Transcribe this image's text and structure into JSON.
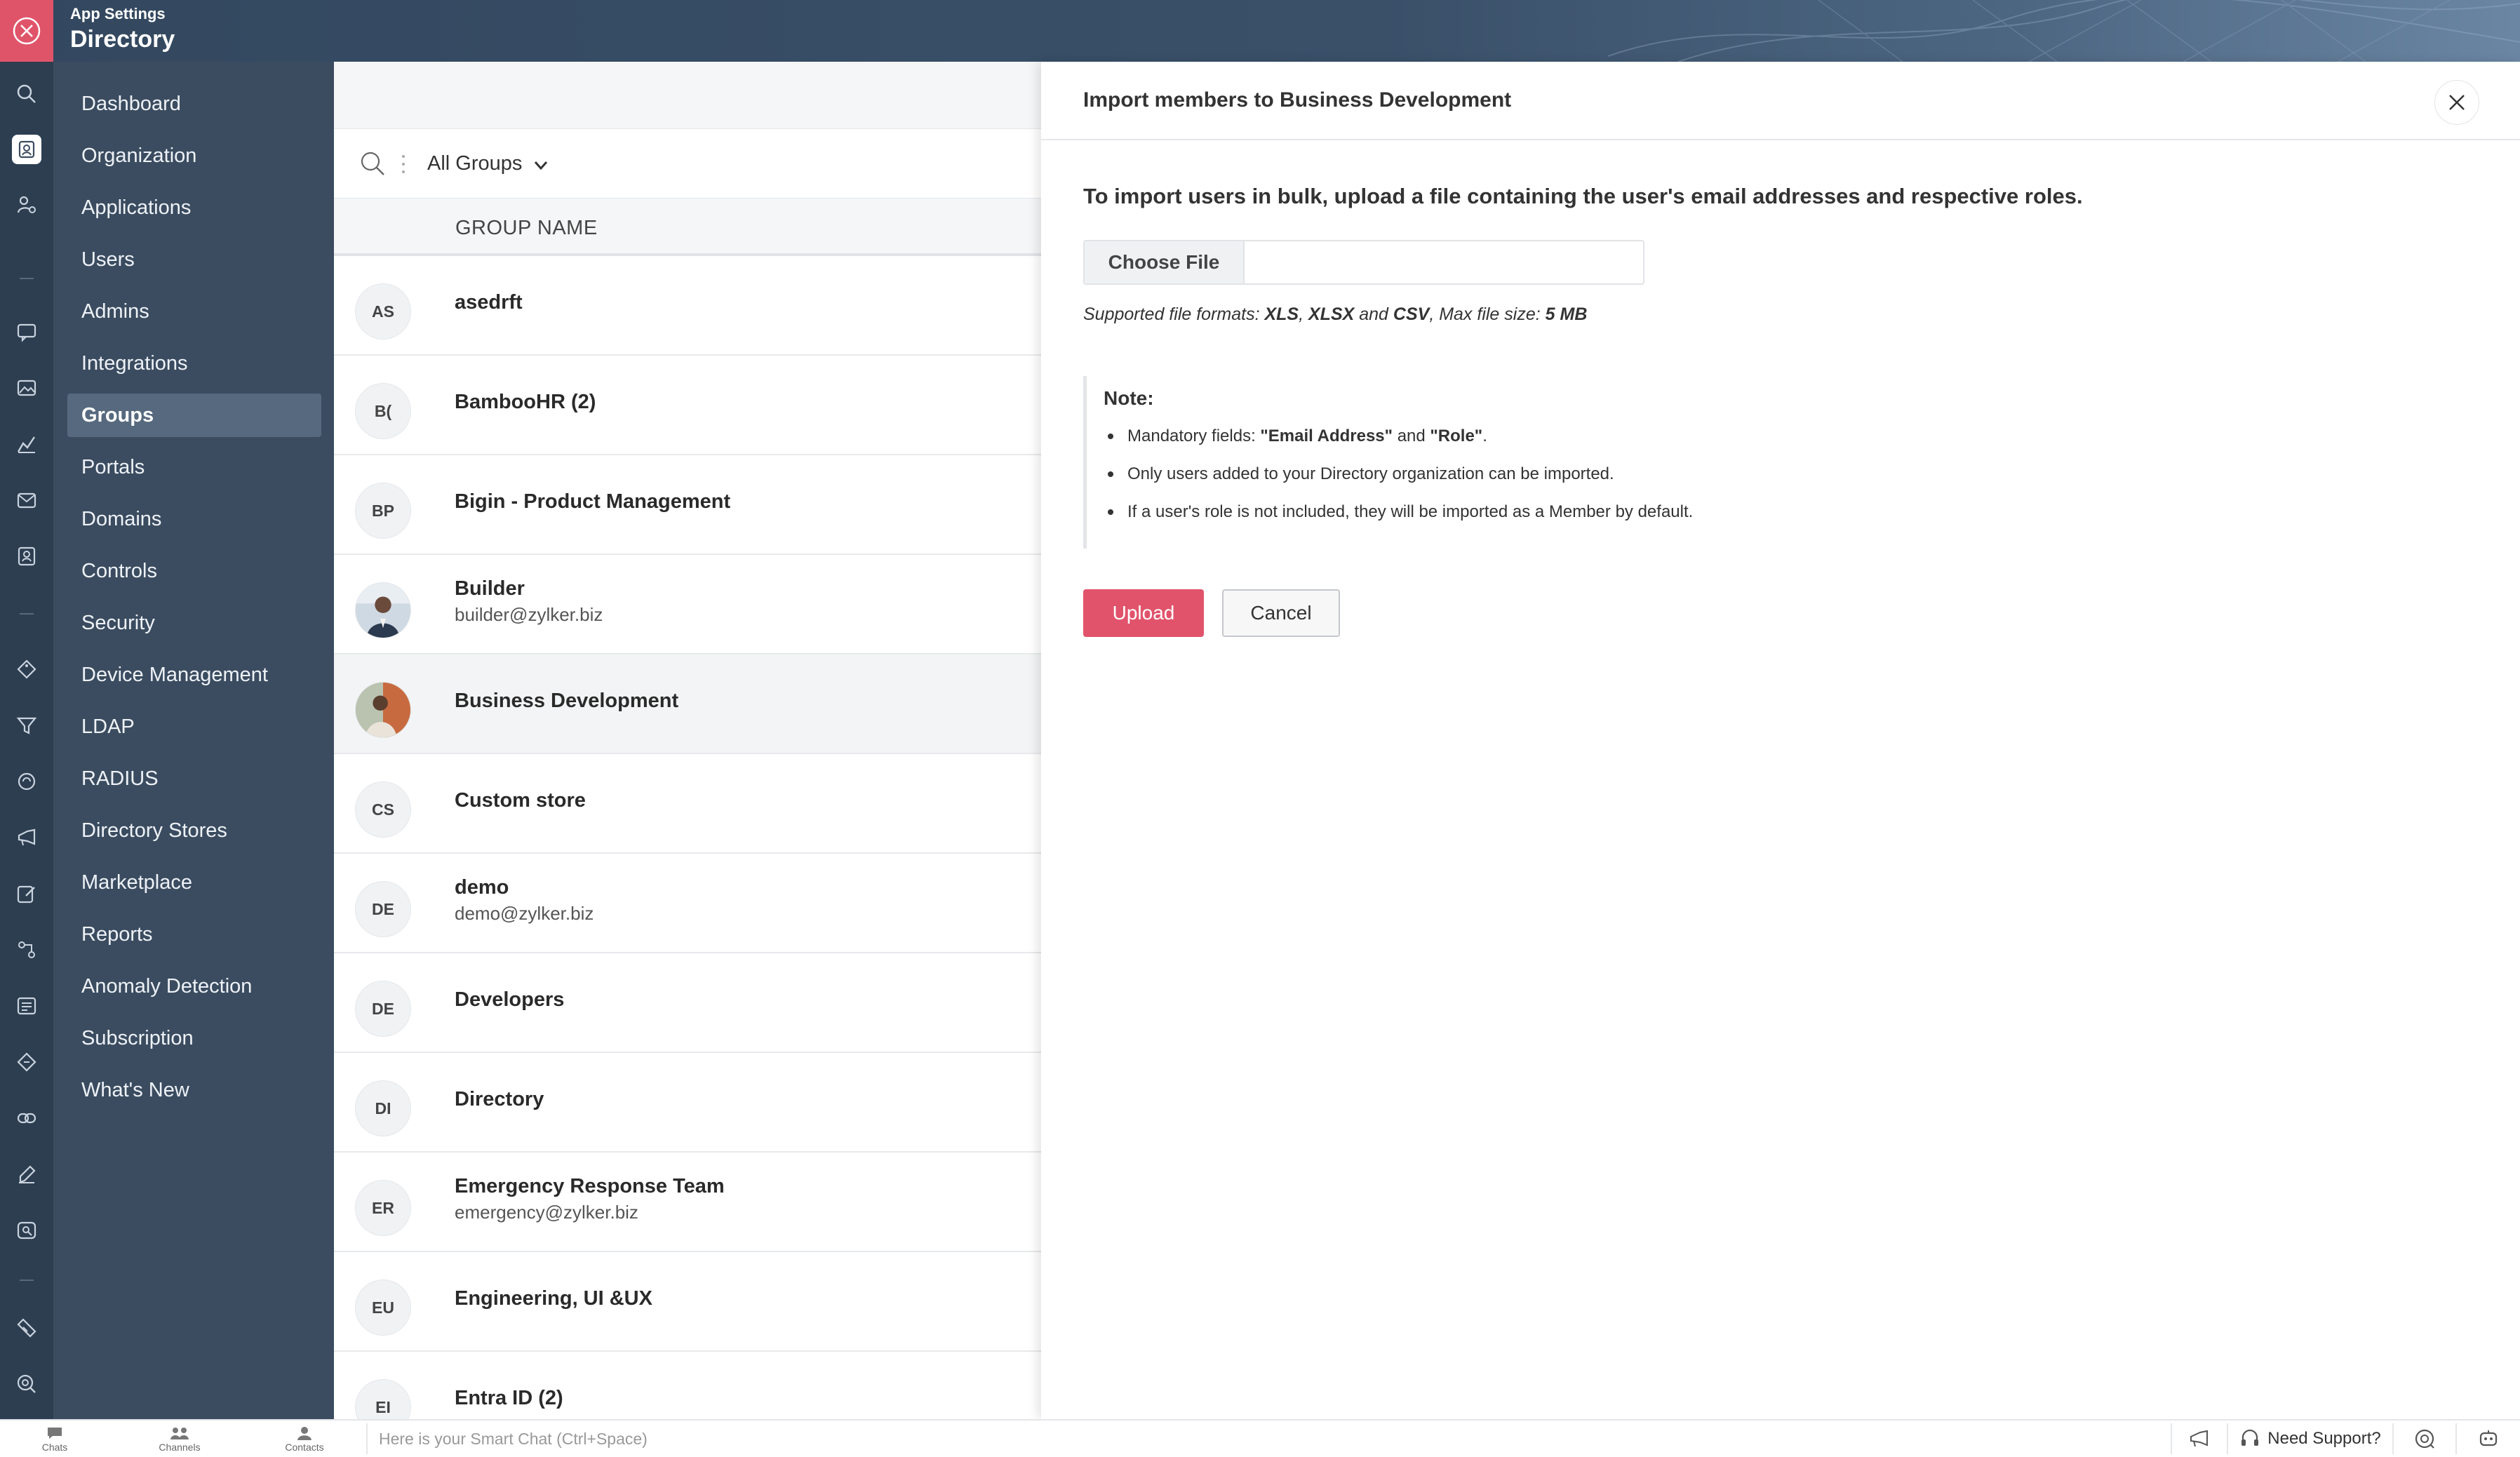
{
  "header": {
    "subtitle": "App Settings",
    "title": "Directory"
  },
  "menu": {
    "items": [
      {
        "label": "Dashboard"
      },
      {
        "label": "Organization"
      },
      {
        "label": "Applications"
      },
      {
        "label": "Users"
      },
      {
        "label": "Admins"
      },
      {
        "label": "Integrations"
      },
      {
        "label": "Groups",
        "active": true
      },
      {
        "label": "Portals"
      },
      {
        "label": "Domains"
      },
      {
        "label": "Controls"
      },
      {
        "label": "Security"
      },
      {
        "label": "Device Management"
      },
      {
        "label": "LDAP"
      },
      {
        "label": "RADIUS"
      },
      {
        "label": "Directory Stores"
      },
      {
        "label": "Marketplace"
      },
      {
        "label": "Reports"
      },
      {
        "label": "Anomaly Detection"
      },
      {
        "label": "Subscription"
      },
      {
        "label": "What's New"
      }
    ]
  },
  "list": {
    "filter_label": "All Groups",
    "column_header": "GROUP NAME",
    "rows": [
      {
        "initials": "AS",
        "name": "asedrft",
        "email": ""
      },
      {
        "initials": "B(",
        "name": "BambooHR (2)",
        "email": ""
      },
      {
        "initials": "BP",
        "name": "Bigin - Product Management",
        "email": ""
      },
      {
        "initials": "",
        "name": "Builder",
        "email": "builder@zylker.biz",
        "photo": true
      },
      {
        "initials": "",
        "name": "Business Development",
        "email": "",
        "photo": true,
        "selected": true
      },
      {
        "initials": "CS",
        "name": "Custom store",
        "email": ""
      },
      {
        "initials": "DE",
        "name": "demo",
        "email": "demo@zylker.biz"
      },
      {
        "initials": "DE",
        "name": "Developers",
        "email": ""
      },
      {
        "initials": "DI",
        "name": "Directory",
        "email": ""
      },
      {
        "initials": "ER",
        "name": "Emergency Response Team",
        "email": "emergency@zylker.biz"
      },
      {
        "initials": "EU",
        "name": "Engineering, UI &UX",
        "email": ""
      },
      {
        "initials": "EI",
        "name": "Entra ID (2)",
        "email": ""
      }
    ]
  },
  "dialog": {
    "title": "Import members to Business Development",
    "intro": "To import users in bulk, upload a file containing the user's email addresses and respective roles.",
    "choose_file_label": "Choose File",
    "formats": {
      "prefix": "Supported file formats: ",
      "f1": "XLS",
      "sep1": ", ",
      "f2": "XLSX",
      "and": " and ",
      "f3": "CSV",
      "size_prefix": ", Max file size: ",
      "size": "5 MB"
    },
    "note_title": "Note:",
    "note_1_prefix": "Mandatory fields: ",
    "note_1_field1": "\"Email Address\"",
    "note_1_and": " and ",
    "note_1_field2": "\"Role\"",
    "note_1_end": ".",
    "note_2": "Only users added to your Directory organization can be imported.",
    "note_3": "If a user's role is not included, they will be imported as a Member by default.",
    "upload_label": "Upload",
    "cancel_label": "Cancel"
  },
  "bottombar": {
    "tabs": [
      "Chats",
      "Channels",
      "Contacts"
    ],
    "smart_chat_placeholder": "Here is your Smart Chat (Ctrl+Space)",
    "support_label": "Need Support?"
  },
  "colors": {
    "accent": "#e1536b",
    "sidebar": "#3b4c60",
    "rail": "#2d3e51"
  },
  "icons": {
    "rail": [
      "search-icon",
      "directory-icon",
      "user-settings-icon",
      "chat-icon",
      "image-icon",
      "chart-icon",
      "mail-icon",
      "contacts-icon",
      "tag-icon",
      "filter-icon",
      "sync-icon",
      "megaphone-icon",
      "edit-icon",
      "flow-icon",
      "list-icon",
      "ticket-icon",
      "link-icon",
      "pen-icon",
      "analytics-icon",
      "coupon-icon",
      "search-zoom-icon"
    ]
  }
}
